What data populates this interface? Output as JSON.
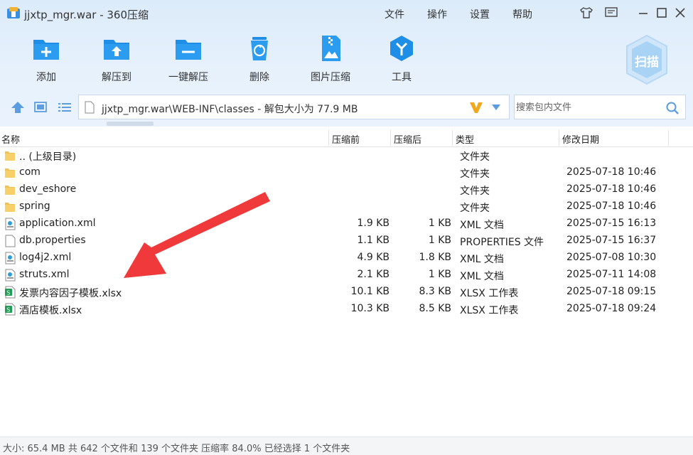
{
  "window": {
    "title": "jjxtp_mgr.war - 360压缩",
    "menus": [
      "文件",
      "操作",
      "设置",
      "帮助"
    ]
  },
  "toolbar": {
    "add": "添加",
    "extract_to": "解压到",
    "one_click_extract": "一键解压",
    "delete": "删除",
    "image_compress": "图片压缩",
    "tools": "工具",
    "scan": "扫描"
  },
  "address": {
    "path": "jjxtp_mgr.war\\WEB-INF\\classes - 解包大小为 77.9 MB",
    "search_placeholder": "搜索包内文件"
  },
  "columns": {
    "name": "名称",
    "packed": "压缩前",
    "original": "压缩后",
    "type": "类型",
    "modified": "修改日期"
  },
  "rows": [
    {
      "icon": "folder",
      "name": ".. (上级目录)",
      "packed": "",
      "original": "",
      "type": "文件夹",
      "modified": ""
    },
    {
      "icon": "folder",
      "name": "com",
      "packed": "",
      "original": "",
      "type": "文件夹",
      "modified": "2025-07-18 10:46"
    },
    {
      "icon": "folder",
      "name": "dev_eshore",
      "packed": "",
      "original": "",
      "type": "文件夹",
      "modified": "2025-07-18 10:46"
    },
    {
      "icon": "folder",
      "name": "spring",
      "packed": "",
      "original": "",
      "type": "文件夹",
      "modified": "2025-07-18 10:46"
    },
    {
      "icon": "xml",
      "name": "application.xml",
      "packed": "1.9 KB",
      "original": "1 KB",
      "type": "XML 文档",
      "modified": "2025-07-15 16:13"
    },
    {
      "icon": "file",
      "name": "db.properties",
      "packed": "1.1 KB",
      "original": "1 KB",
      "type": "PROPERTIES 文件",
      "modified": "2025-07-15 16:37"
    },
    {
      "icon": "xml",
      "name": "log4j2.xml",
      "packed": "4.9 KB",
      "original": "1.8 KB",
      "type": "XML 文档",
      "modified": "2025-07-08 10:30"
    },
    {
      "icon": "xml",
      "name": "struts.xml",
      "packed": "2.1 KB",
      "original": "1 KB",
      "type": "XML 文档",
      "modified": "2025-07-11 14:08"
    },
    {
      "icon": "xlsx",
      "name": "发票内容因子模板.xlsx",
      "packed": "10.1 KB",
      "original": "8.3 KB",
      "type": "XLSX 工作表",
      "modified": "2025-07-18 09:15"
    },
    {
      "icon": "xlsx",
      "name": "酒店模板.xlsx",
      "packed": "10.3 KB",
      "original": "8.5 KB",
      "type": "XLSX 工作表",
      "modified": "2025-07-18 09:24"
    }
  ],
  "status": {
    "text": "大小: 65.4 MB 共 642 个文件和 139 个文件夹 压缩率 84.0% 已经选择 1 个文件夹"
  },
  "colors": {
    "accent": "#1e8ee6",
    "arrow": "#f0393b",
    "folder": "#f2c14e",
    "xlsx": "#1f9d55"
  }
}
